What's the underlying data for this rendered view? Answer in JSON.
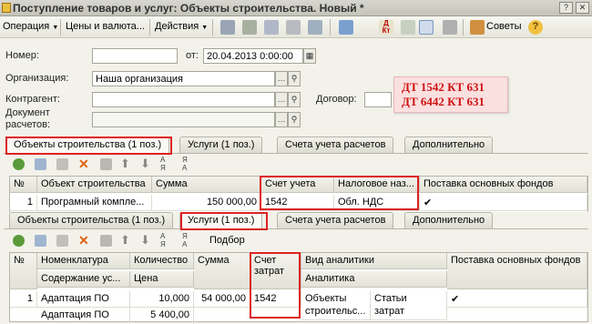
{
  "window": {
    "title": "Поступление товаров и услуг: Объекты строительства. Новый *"
  },
  "toolbar": {
    "operation": "Операция",
    "prices": "Цены и валюта...",
    "actions": "Действия",
    "advice": "Советы"
  },
  "form": {
    "number_label": "Номер:",
    "number_value": "",
    "from_label": "от:",
    "date_value": "20.04.2013  0:00:00",
    "org_label": "Организация:",
    "org_value": "Наша организация",
    "contractor_label": "Контрагент:",
    "contractor_value": "",
    "contract_label": "Договор:",
    "contract_value": "",
    "doc_label_1": "Документ",
    "doc_label_2": "расчетов:",
    "doc_value": ""
  },
  "note": {
    "line1": "ДТ 1542 КТ 631",
    "line2": "ДТ 6442 КТ 631"
  },
  "tabs1": [
    "Объекты строительства (1 поз.)",
    "Услуги (1 поз.)",
    "Счета учета расчетов",
    "Дополнительно"
  ],
  "grid1": {
    "headers": [
      "№",
      "Объект строительства",
      "Сумма",
      "Счет учета",
      "Налоговое наз...",
      "Поставка основных фондов"
    ],
    "rows": [
      [
        "1",
        "Програмный компле...",
        "150 000,00",
        "1542",
        "Обл. НДС",
        "✔"
      ]
    ]
  },
  "tabs2": [
    "Объекты строительства (1 поз.)",
    "Услуги (1 поз.)",
    "Счета учета расчетов",
    "Дополнительно"
  ],
  "grid2": {
    "select_label": "Подбор",
    "headers_top": [
      "№",
      "Номенклатура",
      "Количество",
      "Сумма",
      "Счет затрат",
      "Вид аналитики",
      "Поставка основных фондов"
    ],
    "headers_bottom": [
      "Содержание ус...",
      "Цена",
      "Аналитика"
    ],
    "rows": [
      {
        "n": "1",
        "item": "Адаптация ПО",
        "qty": "10,000",
        "sum": "54 000,00",
        "account": "1542",
        "analytics": "Объекты",
        "analytics2": "строительс...",
        "detail": "Статьи",
        "detail2": "затрат",
        "fixed": "✔"
      },
      {
        "content": "Адаптация ПО",
        "price": "5 400,00"
      }
    ]
  },
  "colors": {
    "highlight": "#dd2222",
    "note_text": "#d01010",
    "note_bg": "#fbe0e0"
  },
  "icons": [
    "app-icon",
    "help-icon",
    "close-icon",
    "add-icon",
    "copy-icon",
    "edit-icon",
    "delete-icon",
    "up-icon",
    "down-icon",
    "sort-asc-icon",
    "sort-desc-icon",
    "advice-icon",
    "search-icon",
    "select-icon"
  ]
}
